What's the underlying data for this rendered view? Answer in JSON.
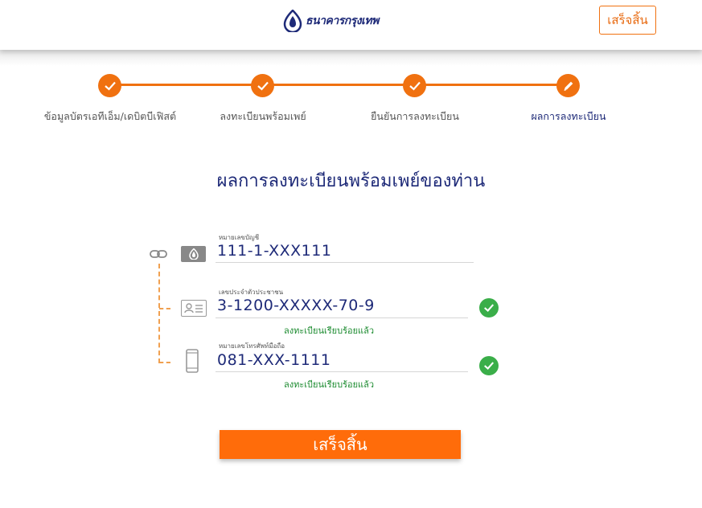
{
  "header": {
    "bank_name": "ธนาคารกรุงเทพ",
    "finish_label": "เสร็จสิ้น"
  },
  "steps": [
    {
      "label": "ข้อมูลบัตรเอทีเอ็ม/เดบิตบีเฟิสต์",
      "status": "done"
    },
    {
      "label": "ลงทะเบียนพร้อมเพย์",
      "status": "done"
    },
    {
      "label": "ยืนยันการลงทะเบียน",
      "status": "done"
    },
    {
      "label": "ผลการลงทะเบียน",
      "status": "current"
    }
  ],
  "title": "ผลการลงทะเบียนพร้อมเพย์ของท่าน",
  "account": {
    "label": "หมายเลขบัญชี",
    "value": "111-1-XXX111"
  },
  "citizen_id": {
    "label": "เลขประจำตัวประชาชน",
    "value": "3-1200-XXXXX-70-9",
    "status": "ลงทะเบียนเรียบร้อยแล้ว"
  },
  "phone": {
    "label": "หมายเลขโทรศัพท์มือถือ",
    "value": "081-XXX-1111",
    "status": "ลงทะเบียนเรียบร้อยแล้ว"
  },
  "finish_button_label": "เสร็จสิ้น",
  "colors": {
    "accent": "#f07110",
    "navy": "#1e2a78",
    "success": "#3aae49"
  }
}
